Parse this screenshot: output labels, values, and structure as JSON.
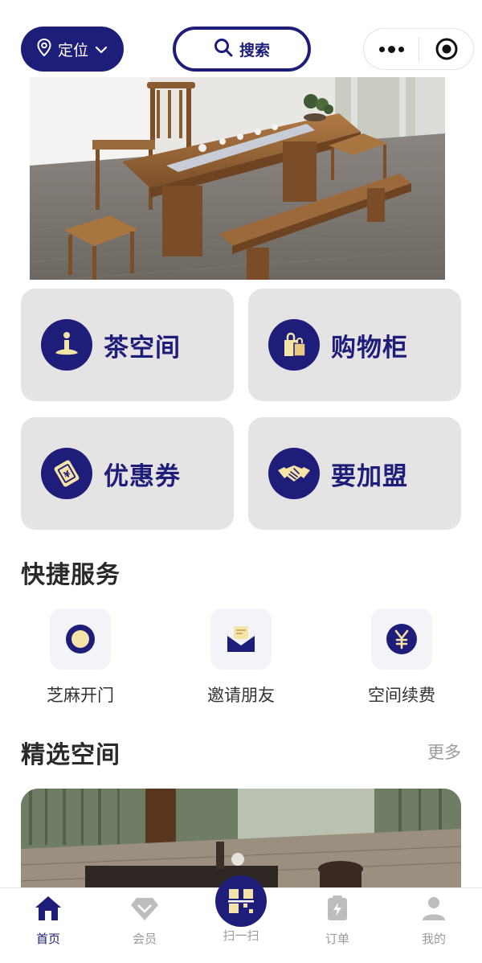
{
  "header": {
    "location_label": "定位",
    "search_label": "搜索"
  },
  "cards": [
    {
      "label": "茶空间",
      "icon": "meditation-icon"
    },
    {
      "label": "购物柜",
      "icon": "shopping-bag-icon"
    },
    {
      "label": "优惠券",
      "icon": "coupon-icon"
    },
    {
      "label": "要加盟",
      "icon": "handshake-icon"
    }
  ],
  "quick_services": {
    "title": "快捷服务",
    "items": [
      {
        "label": "芝麻开门",
        "icon": "door-open-icon"
      },
      {
        "label": "邀请朋友",
        "icon": "invite-envelope-icon"
      },
      {
        "label": "空间续费",
        "icon": "yen-icon"
      }
    ]
  },
  "featured": {
    "title": "精选空间",
    "more_label": "更多"
  },
  "tabbar": {
    "items": [
      {
        "label": "首页",
        "icon": "home-icon",
        "active": true
      },
      {
        "label": "会员",
        "icon": "diamond-icon",
        "active": false
      },
      {
        "label": "扫一扫",
        "icon": "scan-icon",
        "active": false
      },
      {
        "label": "订单",
        "icon": "order-icon",
        "active": false
      },
      {
        "label": "我的",
        "icon": "user-icon",
        "active": false
      }
    ]
  },
  "colors": {
    "primary": "#1f1d7a",
    "card_bg": "#e6e3e5",
    "accent_light": "#f5e3a8"
  }
}
